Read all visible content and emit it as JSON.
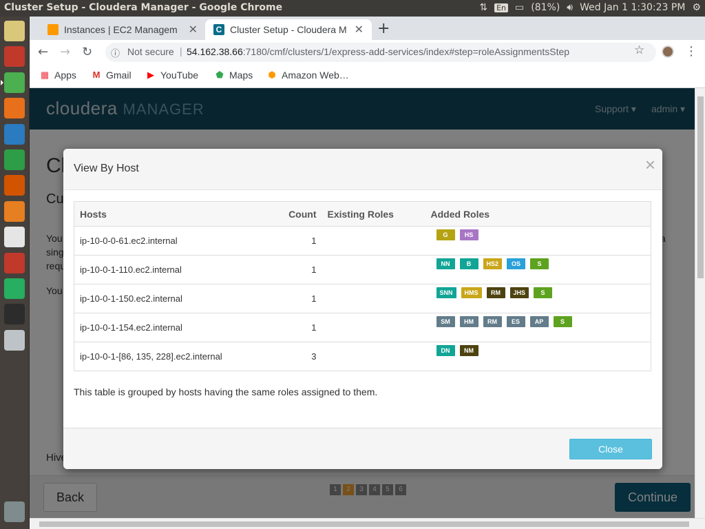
{
  "system": {
    "window_title": "Cluster Setup - Cloudera Manager - Google Chrome",
    "lang": "En",
    "battery": "(81%)",
    "clock": "Wed Jan  1  1:30:23 PM"
  },
  "launcher": [
    {
      "name": "ubuntu-dash-icon",
      "color": "#d9c87a"
    },
    {
      "name": "files-icon",
      "color": "#c0392b"
    },
    {
      "name": "chrome-icon",
      "color": "#4caf50"
    },
    {
      "name": "firefox-icon",
      "color": "#e8701a"
    },
    {
      "name": "writer-icon",
      "color": "#2b7bc0"
    },
    {
      "name": "calc-icon",
      "color": "#2e9d47"
    },
    {
      "name": "impress-icon",
      "color": "#d35400"
    },
    {
      "name": "software-center-icon",
      "color": "#e67e22"
    },
    {
      "name": "amazon-icon",
      "color": "#e5e5e5"
    },
    {
      "name": "settings-icon",
      "color": "#c0392b"
    },
    {
      "name": "updater-icon",
      "color": "#27ae60"
    },
    {
      "name": "terminal-icon",
      "color": "#2c2c2c"
    },
    {
      "name": "text-editor-icon",
      "color": "#bdc3c7"
    },
    {
      "name": "trash-icon",
      "color": "#7f8c8d"
    }
  ],
  "browser": {
    "tabs": [
      {
        "title": "Instances | EC2 Managem",
        "active": false,
        "favicon_color": "#f90"
      },
      {
        "title": "Cluster Setup - Cloudera M",
        "active": true,
        "favicon_color": "#0a6e8a"
      }
    ],
    "address": {
      "security": "Not secure",
      "separator": "|",
      "host": "54.162.38.66",
      "rest": ":7180/cmf/clusters/1/express-add-services/index#step=roleAssignmentsStep"
    },
    "bookmarks": [
      "Apps",
      "Gmail",
      "YouTube",
      "Maps",
      "Amazon Web…"
    ]
  },
  "cm": {
    "logo_main": "cloudera",
    "logo_sub": "MANAGER",
    "nav_support": "Support ▾",
    "nav_admin": "admin ▾",
    "bg_title": "Cl",
    "bg_subtitle": "Cu",
    "bg_line1": "You",
    "bg_line2": "sing",
    "bg_line3": "requ",
    "bg_line4": "You",
    "bg_line1_tail": "a",
    "bg_hive": "Hive",
    "back": "Back",
    "continue": "Continue",
    "steps": [
      "1",
      "2",
      "3",
      "4",
      "5",
      "6"
    ]
  },
  "modal": {
    "title": "View By Host",
    "close_x": "×",
    "columns": [
      "Hosts",
      "Count",
      "Existing Roles",
      "Added Roles"
    ],
    "rows": [
      {
        "host": "ip-10-0-0-61.ec2.internal",
        "count": "1",
        "existing": "",
        "roles": [
          {
            "label": "G",
            "color": "#b5a313"
          },
          {
            "label": "HS",
            "color": "#a875c4"
          }
        ]
      },
      {
        "host": "ip-10-0-1-110.ec2.internal",
        "count": "1",
        "existing": "",
        "roles": [
          {
            "label": "NN",
            "color": "#12a596"
          },
          {
            "label": "B",
            "color": "#12a596"
          },
          {
            "label": "HS2",
            "color": "#c9a61a"
          },
          {
            "label": "OS",
            "color": "#2aa1d8"
          },
          {
            "label": "S",
            "color": "#5ea31f"
          }
        ]
      },
      {
        "host": "ip-10-0-1-150.ec2.internal",
        "count": "1",
        "existing": "",
        "roles": [
          {
            "label": "SNN",
            "color": "#12a596"
          },
          {
            "label": "HMS",
            "color": "#c9a61a"
          },
          {
            "label": "RM",
            "color": "#4e4210"
          },
          {
            "label": "JHS",
            "color": "#4e4210"
          },
          {
            "label": "S",
            "color": "#5ea31f"
          }
        ]
      },
      {
        "host": "ip-10-0-1-154.ec2.internal",
        "count": "1",
        "existing": "",
        "roles": [
          {
            "label": "SM",
            "color": "#627c8a"
          },
          {
            "label": "HM",
            "color": "#627c8a"
          },
          {
            "label": "RM",
            "color": "#627c8a"
          },
          {
            "label": "ES",
            "color": "#627c8a"
          },
          {
            "label": "AP",
            "color": "#627c8a"
          },
          {
            "label": "S",
            "color": "#5ea31f"
          }
        ]
      },
      {
        "host": "ip-10-0-1-[86, 135, 228].ec2.internal",
        "count": "3",
        "existing": "",
        "roles": [
          {
            "label": "DN",
            "color": "#12a596"
          },
          {
            "label": "NM",
            "color": "#4e4210"
          }
        ]
      }
    ],
    "note": "This table is grouped by hosts having the same roles assigned to them.",
    "close_button": "Close"
  }
}
